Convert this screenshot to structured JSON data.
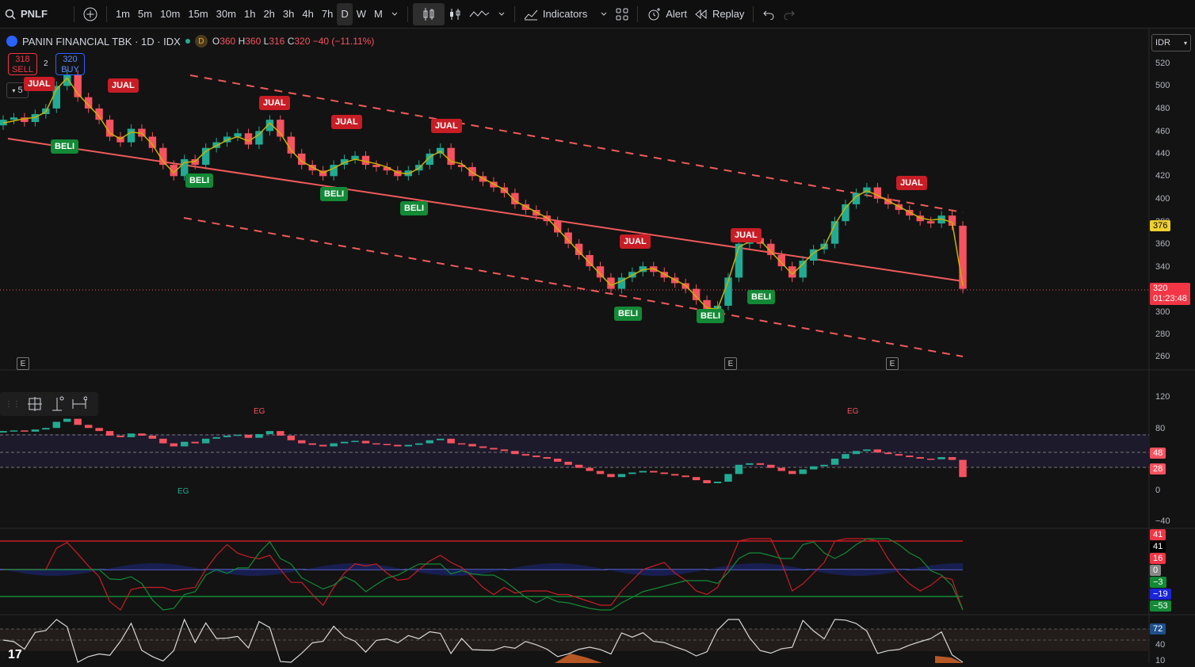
{
  "toolbar": {
    "symbol": "PNLF",
    "timeframes": [
      "1m",
      "5m",
      "10m",
      "15m",
      "30m",
      "1h",
      "2h",
      "3h",
      "4h",
      "7h",
      "D",
      "W",
      "M"
    ],
    "active_timeframe": "D",
    "indicators_label": "Indicators",
    "alert_label": "Alert",
    "replay_label": "Replay"
  },
  "legend": {
    "title": "PANIN FINANCIAL TBK · 1D · IDX",
    "d_badge": "D",
    "open_label": "O",
    "open": "360",
    "high_label": "H",
    "high": "360",
    "low_label": "L",
    "low": "316",
    "close_label": "C",
    "close": "320",
    "change": "−40 (−11.11%)"
  },
  "trade": {
    "sell_price": "318",
    "sell_label": "SELL",
    "spread": "2",
    "buy_price": "320",
    "buy_label": "BUY"
  },
  "interval_box": "5",
  "currency": "IDR",
  "price_axis": [
    "520",
    "500",
    "480",
    "460",
    "440",
    "420",
    "400",
    "380",
    "360",
    "340",
    "300",
    "280",
    "260"
  ],
  "last_price_tag": "376",
  "current_price": "320",
  "countdown": "01:23:48",
  "osc1_axis": [
    "120",
    "80",
    "0",
    "−40"
  ],
  "osc1_tags": [
    "48",
    "28"
  ],
  "osc2_tags": [
    "41",
    "41",
    "16",
    "0",
    "−3",
    "−19",
    "−53"
  ],
  "osc3_tags": [
    "72",
    "40",
    "10"
  ],
  "signals": {
    "jual": "JUAL",
    "beli": "BELI",
    "eg": "EG",
    "e": "E"
  },
  "colors": {
    "up": "#22ab94",
    "down": "#f7525f",
    "jual": "#c81d25",
    "beli": "#138a36",
    "trend": "#f05a5a"
  },
  "chart_data": {
    "type": "candlestick",
    "title": "PANIN FINANCIAL TBK · 1D · IDX",
    "ylabel": "IDR",
    "ylim": [
      250,
      530
    ],
    "close_series": [
      470,
      472,
      468,
      475,
      480,
      500,
      510,
      490,
      480,
      470,
      455,
      450,
      462,
      455,
      445,
      430,
      420,
      435,
      430,
      445,
      450,
      455,
      458,
      448,
      460,
      470,
      455,
      440,
      430,
      425,
      420,
      430,
      435,
      438,
      430,
      428,
      425,
      420,
      425,
      430,
      440,
      445,
      430,
      428,
      420,
      415,
      410,
      405,
      395,
      390,
      385,
      380,
      370,
      360,
      350,
      340,
      330,
      320,
      330,
      335,
      340,
      335,
      330,
      325,
      320,
      310,
      300,
      305,
      330,
      360,
      365,
      360,
      350,
      340,
      330,
      345,
      355,
      360,
      380,
      395,
      405,
      410,
      400,
      395,
      390,
      385,
      380,
      378,
      385,
      376,
      320
    ]
  }
}
